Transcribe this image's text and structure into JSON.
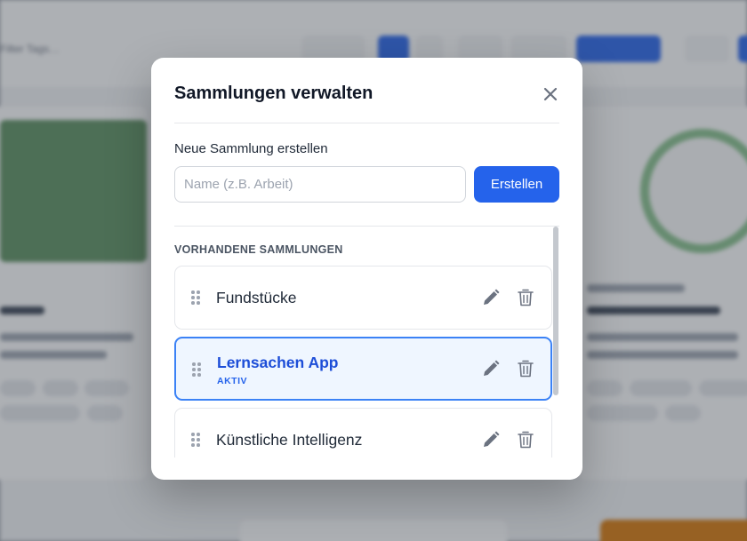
{
  "background": {
    "filter_text": "Filter Tags…"
  },
  "modal": {
    "title": "Sammlungen verwalten",
    "new_collection_label": "Neue Sammlung erstellen",
    "name_input": {
      "value": "",
      "placeholder": "Name (z.B. Arbeit)"
    },
    "create_button_label": "Erstellen",
    "section_heading": "VORHANDENE SAMMLUNGEN",
    "collections": [
      {
        "label": "Fundstücke",
        "active": false,
        "status": ""
      },
      {
        "label": "Lernsachen App",
        "active": true,
        "status": "AKTIV"
      },
      {
        "label": "Künstliche Intelligenz",
        "active": false,
        "status": ""
      }
    ]
  },
  "icons": {
    "close": "close-icon",
    "drag": "drag-handle-icon",
    "edit": "pencil-icon",
    "delete": "trash-icon"
  },
  "colors": {
    "primary": "#2563eb",
    "active_border": "#3b82f6",
    "active_bg": "#eff6ff",
    "active_text": "#1d4ed8",
    "icon_gray": "#6b7280"
  }
}
